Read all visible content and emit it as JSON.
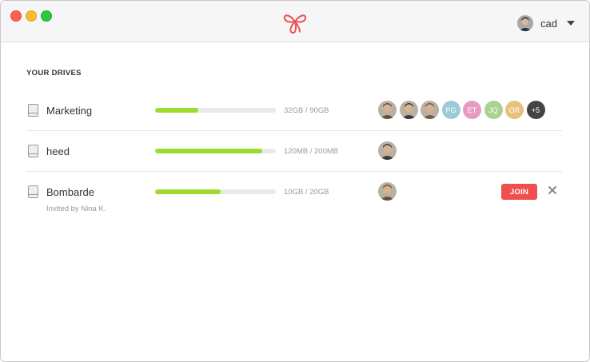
{
  "titlebar": {
    "user_name": "cad"
  },
  "drives": {
    "section_title": "YOUR DRIVES",
    "items": [
      {
        "name": "Marketing",
        "usage": "32GB / 90GB",
        "used_fraction": 0.36,
        "members": [
          {
            "type": "photo",
            "tone": "#6b4f33"
          },
          {
            "type": "photo",
            "tone": "#3b3b3b"
          },
          {
            "type": "photo",
            "tone": "#7a5a3a"
          },
          {
            "type": "initials",
            "initials": "PG",
            "color": "#9bcbd6"
          },
          {
            "type": "initials",
            "initials": "ET",
            "color": "#e59bc2"
          },
          {
            "type": "initials",
            "initials": "JQ",
            "color": "#a9d38e"
          },
          {
            "type": "initials",
            "initials": "OR",
            "color": "#e7c27a"
          },
          {
            "type": "initials",
            "initials": "+5",
            "color": "#444444"
          }
        ]
      },
      {
        "name": "heed",
        "usage": "120MB / 200MB",
        "used_fraction": 0.89,
        "members": [
          {
            "type": "photo",
            "tone": "#3b3b3b"
          }
        ]
      },
      {
        "name": "Bombarde",
        "subtitle": "Invited by Nina K.",
        "usage": "10GB / 20GB",
        "used_fraction": 0.54,
        "members": [
          {
            "type": "photo",
            "tone": "#6b4f33"
          }
        ],
        "join_label": "JOIN"
      }
    ]
  },
  "colors": {
    "accent": "#ef4f4f",
    "progress_fill": "#9ddc2f",
    "progress_track": "#e9e9e9"
  }
}
